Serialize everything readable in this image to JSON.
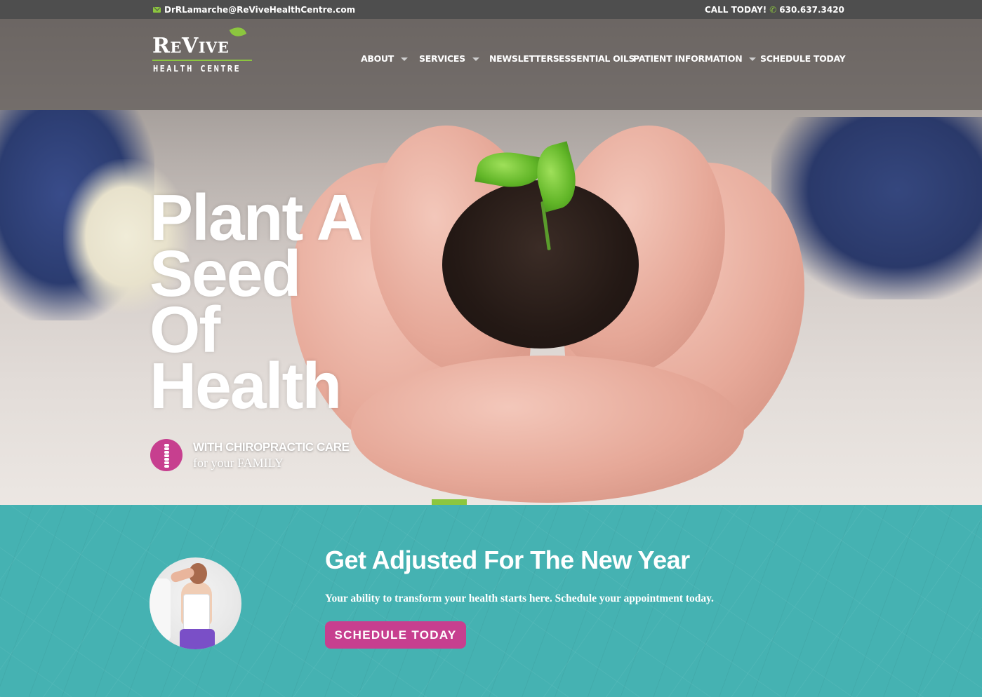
{
  "topbar": {
    "email": "DrRLamarche@ReViveHealthCentre.com",
    "call_label": "CALL TODAY!",
    "phone": "630.637.3420",
    "email_icon": "envelope-icon",
    "phone_icon": "phone-icon"
  },
  "logo": {
    "name": "ReVive",
    "subtitle": "HEALTH CENTRE"
  },
  "nav": {
    "items": [
      {
        "label": "ABOUT",
        "has_dropdown": true
      },
      {
        "label": "SERVICES",
        "has_dropdown": true
      },
      {
        "label": "NEWSLETTERS",
        "has_dropdown": false
      },
      {
        "label": "ESSENTIAL OILS",
        "has_dropdown": false
      },
      {
        "label": "PATIENT INFORMATION",
        "has_dropdown": true
      },
      {
        "label": "SCHEDULE TODAY",
        "has_dropdown": false
      }
    ]
  },
  "hero": {
    "headline_lines": [
      "Plant A",
      "Seed",
      "Of",
      "Health"
    ],
    "tagline_line1": "WITH CHIROPRACTIC CARE",
    "tagline_line2": "for your FAMILY",
    "badge_icon": "spine-icon",
    "slides": {
      "count": 3,
      "active_index": 0
    }
  },
  "promo": {
    "title": "Get Adjusted For The New Year",
    "subtitle": "Your ability to transform your health starts here. Schedule your appointment today.",
    "button_label": "SCHEDULE TODAY"
  },
  "colors": {
    "accent_green": "#8cc63f",
    "brand_pink": "#c73f8f",
    "promo_teal": "#45b2b2",
    "topbar_gray": "#4e4e4e"
  }
}
